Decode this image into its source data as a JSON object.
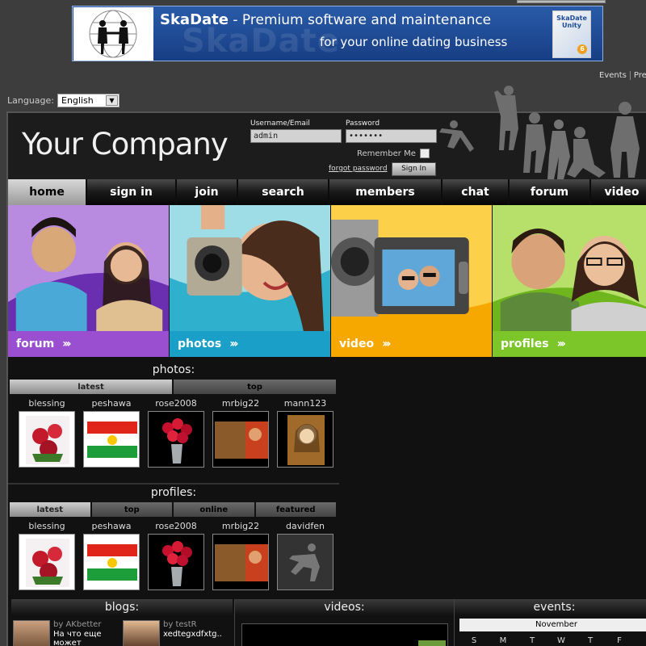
{
  "banner": {
    "brand": "SkaDate",
    "line1_rest": " - Premium software and maintenance",
    "line2": "for your online dating business",
    "box_label": "SkaDate Unity",
    "box_version": "6"
  },
  "top_links": [
    "Events",
    "Pre"
  ],
  "language": {
    "label": "Language:",
    "selected": "English"
  },
  "site": {
    "logo": "Your Company"
  },
  "login": {
    "username_label": "Username/Email",
    "username_value": "admin",
    "password_label": "Password",
    "password_value": "•••••••",
    "remember_label": "Remember Me",
    "forgot_label": "forgot password",
    "signin_label": "Sign In"
  },
  "nav": [
    {
      "label": "home",
      "active": true
    },
    {
      "label": "sign in"
    },
    {
      "label": "join"
    },
    {
      "label": "search"
    },
    {
      "label": "members"
    },
    {
      "label": "chat"
    },
    {
      "label": "forum"
    },
    {
      "label": "video"
    }
  ],
  "tiles": [
    {
      "label": "forum",
      "color": "#9a4fd0"
    },
    {
      "label": "photos",
      "color": "#1a9fc8"
    },
    {
      "label": "video",
      "color": "#f6a800"
    },
    {
      "label": "profiles",
      "color": "#7cc62a"
    }
  ],
  "chevrons": "›››",
  "photos": {
    "title": "photos:",
    "tabs": [
      "latest",
      "top"
    ],
    "items": [
      {
        "name": "blessing",
        "pic": "roses-card"
      },
      {
        "name": "peshawa",
        "pic": "kurdish-flag"
      },
      {
        "name": "rose2008",
        "pic": "rose-vase"
      },
      {
        "name": "mrbig22",
        "pic": "photo-brown"
      },
      {
        "name": "mann123",
        "pic": "photo-portrait"
      }
    ]
  },
  "profiles": {
    "title": "profiles:",
    "tabs": [
      "latest",
      "top",
      "online",
      "featured"
    ],
    "items": [
      {
        "name": "blessing",
        "pic": "roses-card"
      },
      {
        "name": "peshawa",
        "pic": "kurdish-flag"
      },
      {
        "name": "rose2008",
        "pic": "rose-vase"
      },
      {
        "name": "mrbig22",
        "pic": "photo-brown"
      },
      {
        "name": "davidfen",
        "pic": "silhouette-placeholder"
      }
    ]
  },
  "bottom": {
    "blogs_title": "blogs:",
    "videos_title": "videos:",
    "events_title": "events:",
    "blog1_by": "by AKbetter",
    "blog1_text": "На что еще может",
    "blog2_by": "by testR",
    "blog2_text": "xedtegxdfxtg..",
    "calendar_month": "November",
    "calendar_days": [
      "S",
      "M",
      "T",
      "W",
      "T",
      "F"
    ]
  }
}
